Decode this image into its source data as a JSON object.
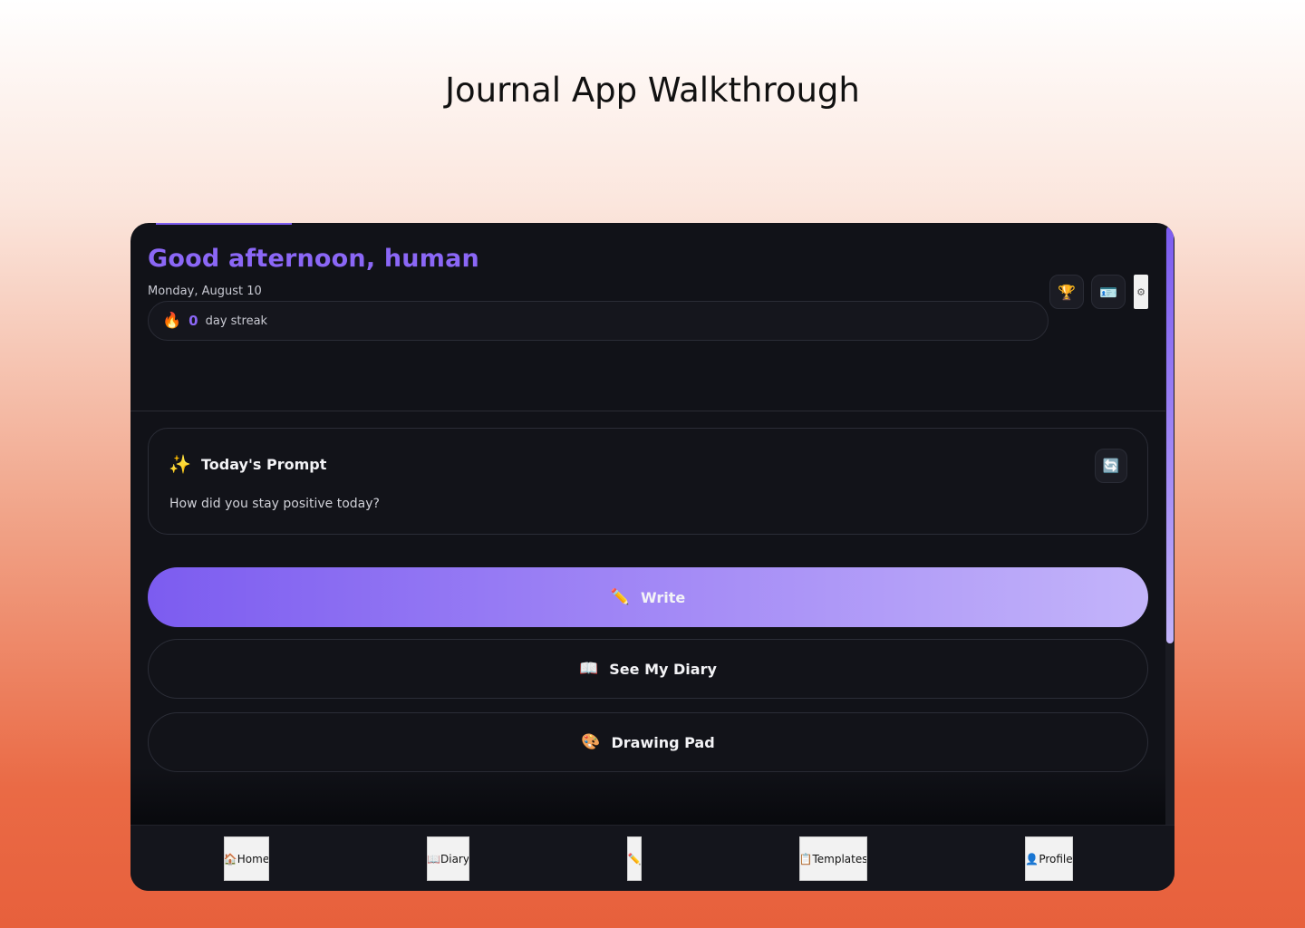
{
  "page": {
    "title": "Journal App Walkthrough"
  },
  "header": {
    "greeting": "Good afternoon, human",
    "date": "Monday, August 10",
    "streak": {
      "icon": "🔥",
      "count": "0",
      "label": "day streak"
    },
    "actions": [
      {
        "name": "trophy-icon",
        "glyph": "🏆"
      },
      {
        "name": "id-card-icon",
        "glyph": "🪪"
      },
      {
        "name": "gear-icon",
        "glyph": "⚙"
      }
    ]
  },
  "prompt": {
    "icon": "✨",
    "title": "Today's Prompt",
    "text": "How did you stay positive today?",
    "refresh_icon": "🔄"
  },
  "buttons": {
    "write": {
      "icon": "✏️",
      "label": "Write"
    },
    "diary": {
      "icon": "📖",
      "label": "See My Diary"
    },
    "drawing": {
      "icon": "🎨",
      "label": "Drawing Pad"
    }
  },
  "nav": {
    "home": {
      "icon": "🏠",
      "label": "Home"
    },
    "diary": {
      "icon": "📖",
      "label": "Diary"
    },
    "write": {
      "icon": "✏️",
      "label": ""
    },
    "templates": {
      "icon": "📋",
      "label": "Templates"
    },
    "profile": {
      "icon": "👤",
      "label": "Profile"
    }
  },
  "colors": {
    "accent": "#8b67f6",
    "background": "#111218",
    "write_gradient_start": "#7c5cf0",
    "write_gradient_end": "#c3b4fa"
  }
}
